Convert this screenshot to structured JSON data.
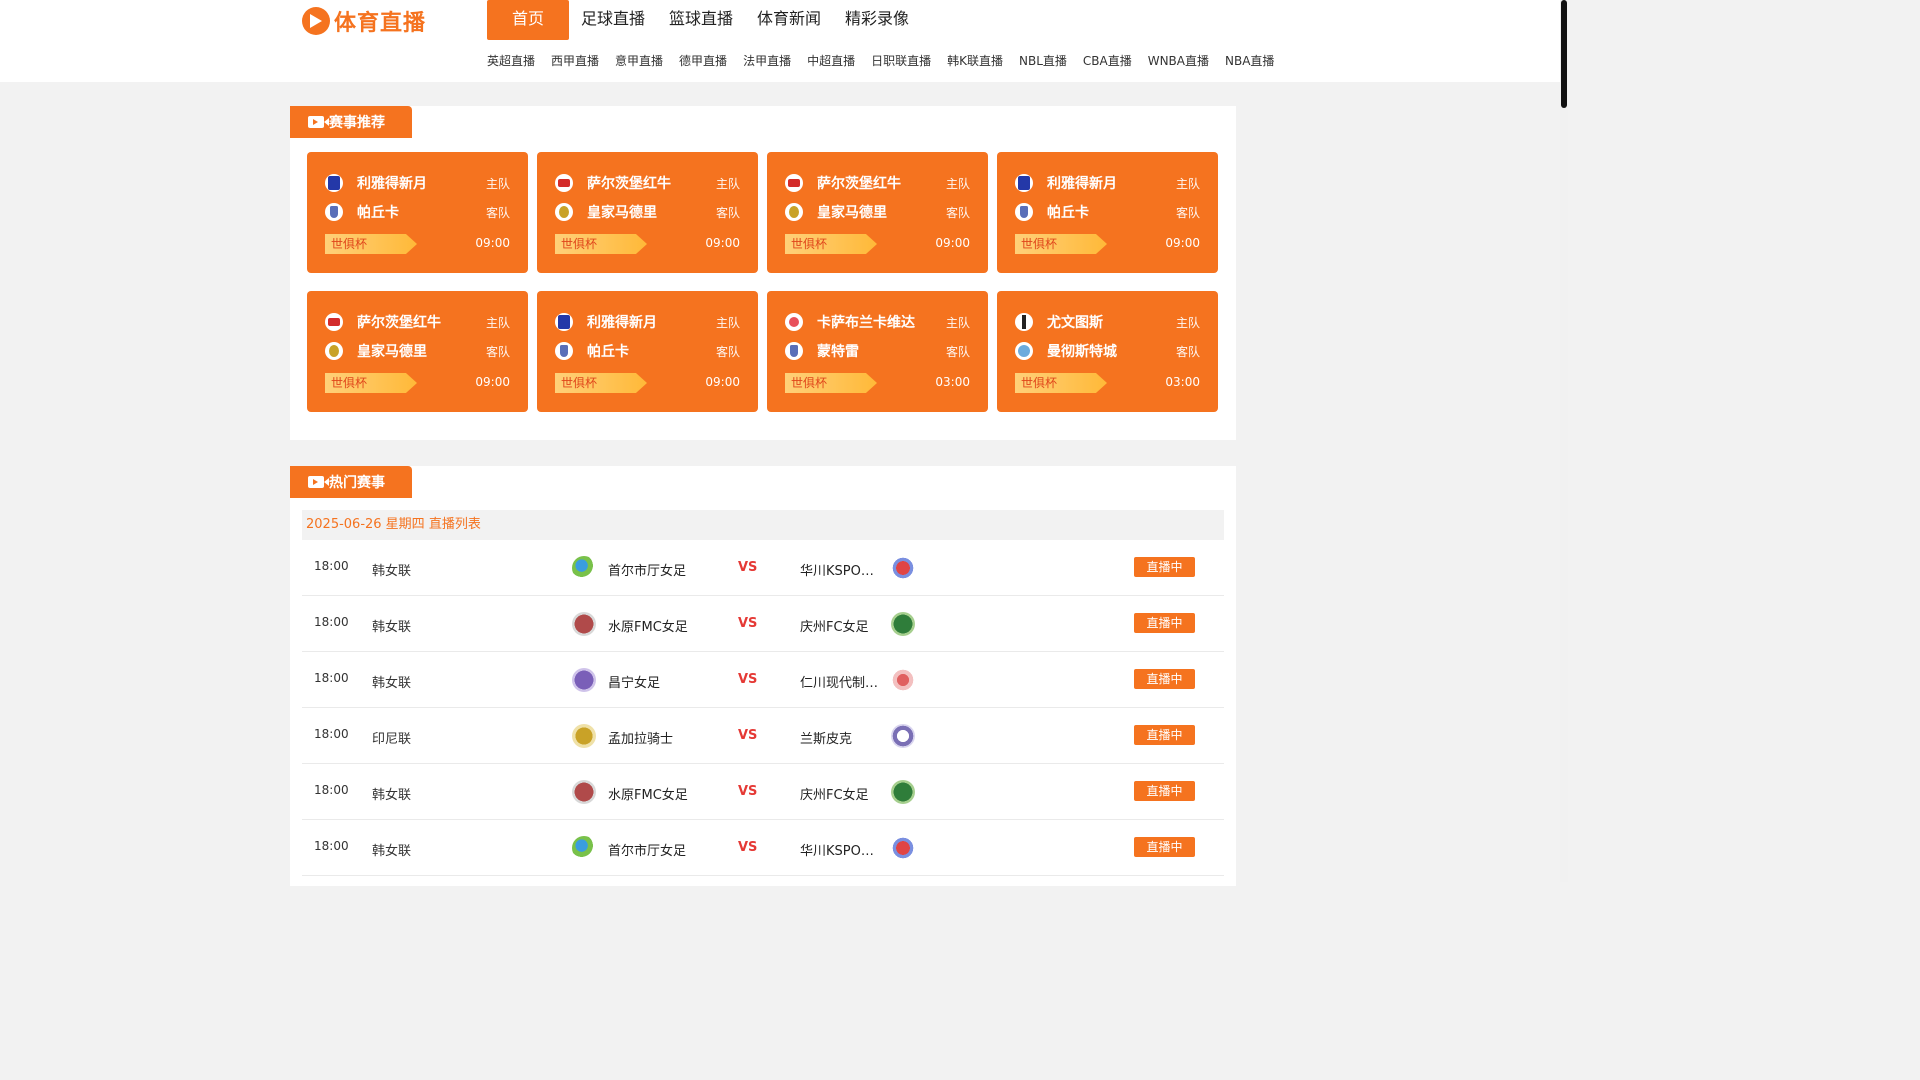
{
  "brand": {
    "name": "体育直播",
    "accent": "#f5731f"
  },
  "nav": {
    "main": [
      "首页",
      "足球直播",
      "篮球直播",
      "体育新闻",
      "精彩录像"
    ],
    "sub": [
      "英超直播",
      "西甲直播",
      "意甲直播",
      "德甲直播",
      "法甲直播",
      "中超直播",
      "日职联直播",
      "韩K联直播",
      "NBL直播",
      "CBA直播",
      "WNBA直播",
      "NBA直播"
    ]
  },
  "recommend": {
    "title": "赛事推荐",
    "home_label": "主队",
    "away_label": "客队",
    "cards": [
      {
        "home": "利雅得新月",
        "home_icon": "blue",
        "away": "帕丘卡",
        "away_icon": "grey",
        "league": "世俱杯",
        "time": "09:00"
      },
      {
        "home": "萨尔茨堡红牛",
        "home_icon": "red",
        "away": "皇家马德里",
        "away_icon": "gold",
        "league": "世俱杯",
        "time": "09:00"
      },
      {
        "home": "萨尔茨堡红牛",
        "home_icon": "red",
        "away": "皇家马德里",
        "away_icon": "gold",
        "league": "世俱杯",
        "time": "09:00"
      },
      {
        "home": "利雅得新月",
        "home_icon": "blue",
        "away": "帕丘卡",
        "away_icon": "grey",
        "league": "世俱杯",
        "time": "09:00"
      },
      {
        "home": "萨尔茨堡红牛",
        "home_icon": "red",
        "away": "皇家马德里",
        "away_icon": "gold",
        "league": "世俱杯",
        "time": "09:00"
      },
      {
        "home": "利雅得新月",
        "home_icon": "blue",
        "away": "帕丘卡",
        "away_icon": "grey",
        "league": "世俱杯",
        "time": "09:00"
      },
      {
        "home": "卡萨布兰卡维达",
        "home_icon": "pink",
        "away": "蒙特雷",
        "away_icon": "grey",
        "league": "世俱杯",
        "time": "03:00"
      },
      {
        "home": "尤文图斯",
        "home_icon": "black",
        "away": "曼彻斯特城",
        "away_icon": "sky",
        "league": "世俱杯",
        "time": "03:00"
      }
    ]
  },
  "hot": {
    "title": "热门赛事",
    "date_header": "2025-06-26 星期四 直播列表",
    "vs_label": "VS",
    "live_label": "直播中",
    "matches": [
      {
        "time": "18:00",
        "league": "韩女联",
        "home": "首尔市厅女足",
        "home_logo": "lg-a",
        "away": "华川KSPO女足",
        "away_logo": "lg-e"
      },
      {
        "time": "18:00",
        "league": "韩女联",
        "home": "水原FMC女足",
        "home_logo": "lg-b",
        "away": "庆州FC女足",
        "away_logo": "lg-f"
      },
      {
        "time": "18:00",
        "league": "韩女联",
        "home": "昌宁女足",
        "home_logo": "lg-c",
        "away": "仁川现代制铁红天使女足",
        "away_logo": "lg-g"
      },
      {
        "time": "18:00",
        "league": "印尼联",
        "home": "孟加拉骑士",
        "home_logo": "lg-d",
        "away": "兰斯皮克",
        "away_logo": "lg-h"
      },
      {
        "time": "18:00",
        "league": "韩女联",
        "home": "水原FMC女足",
        "home_logo": "lg-b",
        "away": "庆州FC女足",
        "away_logo": "lg-f"
      },
      {
        "time": "18:00",
        "league": "韩女联",
        "home": "首尔市厅女足",
        "home_logo": "lg-a",
        "away": "华川KSPO女足",
        "away_logo": "lg-e"
      }
    ]
  }
}
